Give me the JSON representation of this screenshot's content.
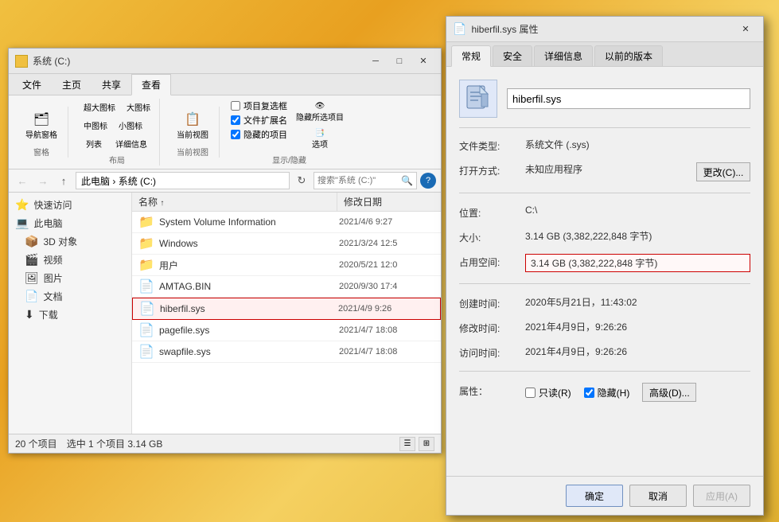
{
  "desktop": {
    "bg": "fruity yellow-orange"
  },
  "explorer": {
    "title": "系统 (C:)",
    "tabs": [
      "文件",
      "主页",
      "共享",
      "查看"
    ],
    "active_tab": "查看",
    "ribbon": {
      "groups": [
        {
          "label": "窗格",
          "items": [
            {
              "icon": "🗂",
              "label": "导航窗格"
            }
          ]
        },
        {
          "label": "布局",
          "view_options": [
            "超大图标",
            "大图标",
            "中图标",
            "小图标",
            "列表",
            "详细信息"
          ]
        },
        {
          "label": "当前视图",
          "items": [
            {
              "icon": "📋",
              "label": "当前\n视图"
            }
          ]
        },
        {
          "label": "显示/隐藏",
          "checkboxes": [
            {
              "label": "项目复选框",
              "checked": false
            },
            {
              "label": "文件扩展名",
              "checked": true
            },
            {
              "label": "隐藏的项目",
              "checked": true
            }
          ],
          "items": [
            {
              "icon": "👁",
              "label": "隐藏\n所选项目"
            },
            {
              "icon": "📑",
              "label": "选项"
            }
          ]
        }
      ]
    },
    "address": {
      "path": "此电脑 › 系统 (C:)",
      "search_placeholder": "搜索\"系统 (C:)\"",
      "search_icon": "🔍"
    },
    "nav_btns": [
      "←",
      "→",
      "↑"
    ],
    "sidebar": [
      {
        "icon": "⭐",
        "label": "快速访问"
      },
      {
        "icon": "💻",
        "label": "此电脑"
      },
      {
        "icon": "📦",
        "label": "3D 对象"
      },
      {
        "icon": "🎬",
        "label": "视频"
      },
      {
        "icon": "🖼",
        "label": "图片"
      },
      {
        "icon": "📄",
        "label": "文档"
      },
      {
        "icon": "⬇",
        "label": "下载"
      }
    ],
    "files": [
      {
        "name": "System Volume Information",
        "date": "2021/4/6 9:27",
        "type": "folder",
        "selected": false
      },
      {
        "name": "Windows",
        "date": "2021/3/24 12:5",
        "type": "folder",
        "selected": false
      },
      {
        "name": "用户",
        "date": "2020/5/21 12:0",
        "type": "folder",
        "selected": false
      },
      {
        "name": "AMTAG.BIN",
        "date": "2020/9/30 17:4",
        "type": "file",
        "selected": false
      },
      {
        "name": "hiberfil.sys",
        "date": "2021/4/9 9:26",
        "type": "sys",
        "selected": true,
        "highlighted": true
      },
      {
        "name": "pagefile.sys",
        "date": "2021/4/7 18:08",
        "type": "sys",
        "selected": false
      },
      {
        "name": "swapfile.sys",
        "date": "2021/4/7 18:08",
        "type": "sys",
        "selected": false
      }
    ],
    "status": {
      "item_count": "20 个项目",
      "selected_info": "选中 1 个项目  3.14 GB"
    },
    "col_name": "名称",
    "col_date": "修改日期",
    "col_sort": "↑"
  },
  "properties": {
    "title": "hiberfil.sys 属性",
    "title_icon": "📄",
    "tabs": [
      "常规",
      "安全",
      "详细信息",
      "以前的版本"
    ],
    "active_tab": "常规",
    "file_icon": "📄",
    "filename": "hiberfil.sys",
    "rows": [
      {
        "label": "文件类型:",
        "value": "系统文件 (.sys)",
        "highlight": false
      },
      {
        "label": "打开方式:",
        "value": "未知应用程序",
        "highlight": false,
        "has_button": true,
        "button_label": "更改(C)..."
      },
      {
        "label": "位置:",
        "value": "C:\\",
        "highlight": false
      },
      {
        "label": "大小:",
        "value": "3.14 GB (3,382,222,848 字节)",
        "highlight": false
      },
      {
        "label": "占用空间:",
        "value": "3.14 GB (3,382,222,848 字节)",
        "highlight": true
      },
      {
        "label": "创建时间:",
        "value": "2020年5月21日，11:43:02",
        "highlight": false
      },
      {
        "label": "修改时间:",
        "value": "2021年4月9日，9:26:26",
        "highlight": false
      },
      {
        "label": "访问时间:",
        "value": "2021年4月9日，9:26:26",
        "highlight": false
      }
    ],
    "attrs_label": "属性：",
    "attrs": [
      {
        "label": "只读(R)",
        "checked": false
      },
      {
        "label": "隐藏(H)",
        "checked": true
      }
    ],
    "advanced_btn": "高级(D)...",
    "footer_btns": [
      {
        "label": "确定",
        "type": "primary"
      },
      {
        "label": "取消",
        "type": "normal"
      },
      {
        "label": "应用(A)",
        "type": "disabled"
      }
    ]
  }
}
